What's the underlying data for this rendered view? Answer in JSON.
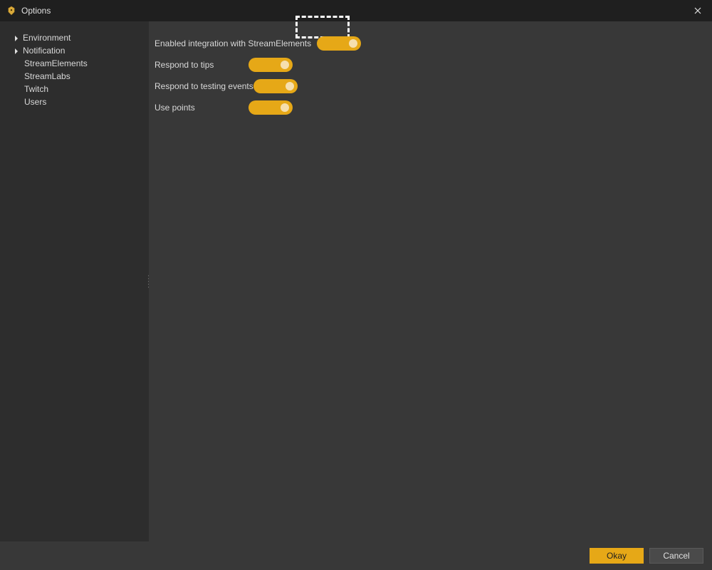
{
  "window": {
    "title": "Options"
  },
  "sidebar": {
    "items": [
      {
        "label": "Environment",
        "expandable": true
      },
      {
        "label": "Notification",
        "expandable": true
      },
      {
        "label": "StreamElements",
        "expandable": false
      },
      {
        "label": "StreamLabs",
        "expandable": false
      },
      {
        "label": "Twitch",
        "expandable": false
      },
      {
        "label": "Users",
        "expandable": false
      }
    ]
  },
  "settings": {
    "rows": [
      {
        "label": "Enabled integration with StreamElements",
        "on": true,
        "highlighted": true
      },
      {
        "label": "Respond to tips",
        "on": true,
        "highlighted": false
      },
      {
        "label": "Respond to testing events",
        "on": true,
        "highlighted": false
      },
      {
        "label": "Use points",
        "on": true,
        "highlighted": false
      }
    ]
  },
  "footer": {
    "okay_label": "Okay",
    "cancel_label": "Cancel"
  },
  "colors": {
    "accent": "#e6a817",
    "bg": "#383838",
    "sidebar": "#2d2d2d",
    "titlebar": "#1f1f1f"
  }
}
